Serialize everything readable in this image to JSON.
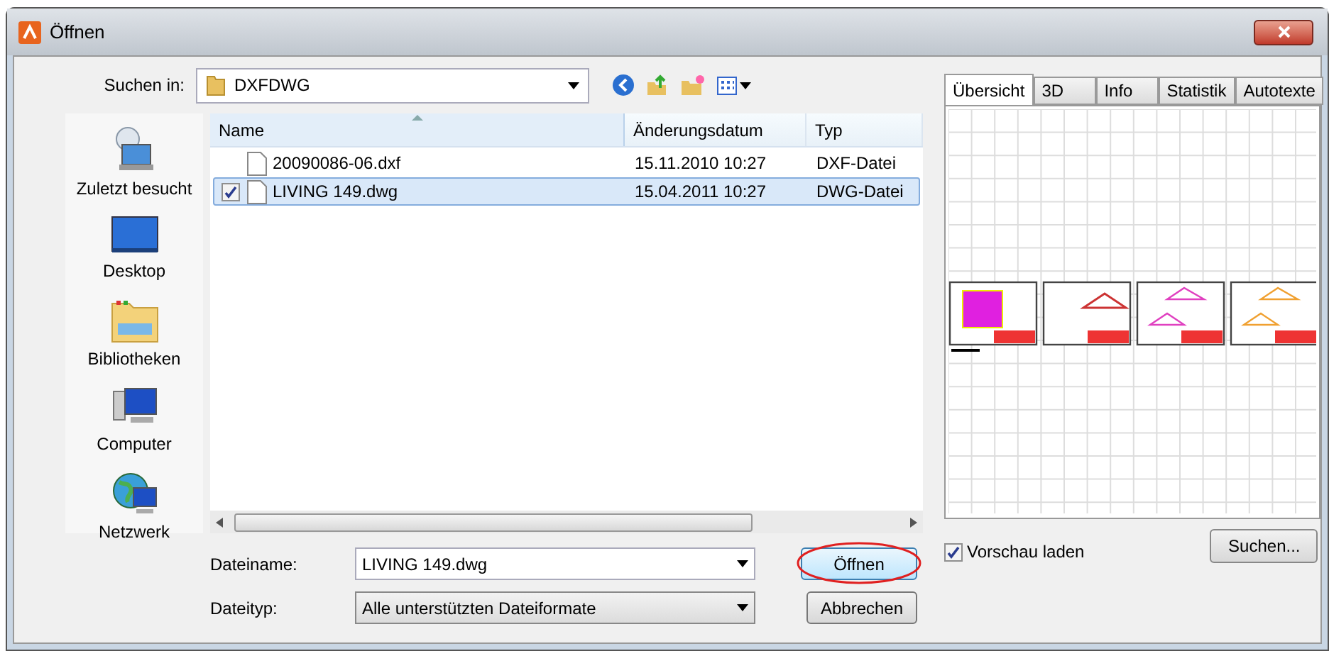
{
  "window": {
    "title": "Öffnen"
  },
  "look_in": {
    "label": "Suchen in:",
    "value": "DXFDWG"
  },
  "places": [
    {
      "label": "Zuletzt besucht",
      "kind": "recent"
    },
    {
      "label": "Desktop",
      "kind": "desktop"
    },
    {
      "label": "Bibliotheken",
      "kind": "libraries"
    },
    {
      "label": "Computer",
      "kind": "computer"
    },
    {
      "label": "Netzwerk",
      "kind": "network"
    }
  ],
  "table": {
    "columns": [
      {
        "label": "Name",
        "sorted": true
      },
      {
        "label": "Änderungsdatum",
        "sorted": false
      },
      {
        "label": "Typ",
        "sorted": false
      }
    ],
    "rows": [
      {
        "name": "20090086-06.dxf",
        "date": "15.11.2010 10:27",
        "type": "DXF-Datei",
        "selected": false,
        "checked": false
      },
      {
        "name": "LIVING 149.dwg",
        "date": "15.04.2011 10:27",
        "type": "DWG-Datei",
        "selected": true,
        "checked": true
      }
    ]
  },
  "file_name": {
    "label": "Dateiname:",
    "value": "LIVING 149.dwg"
  },
  "file_type": {
    "label": "Dateityp:",
    "value": "Alle unterstützten Dateiformate"
  },
  "buttons": {
    "open": "Öffnen",
    "cancel": "Abbrechen",
    "search": "Suchen..."
  },
  "preview_tabs": [
    {
      "label": "Übersicht",
      "selected": true
    },
    {
      "label": "3D",
      "selected": false
    },
    {
      "label": "Info",
      "selected": false
    },
    {
      "label": "Statistik",
      "selected": false
    },
    {
      "label": "Autotexte",
      "selected": false
    }
  ],
  "load_preview": {
    "label": "Vorschau laden",
    "checked": true
  }
}
